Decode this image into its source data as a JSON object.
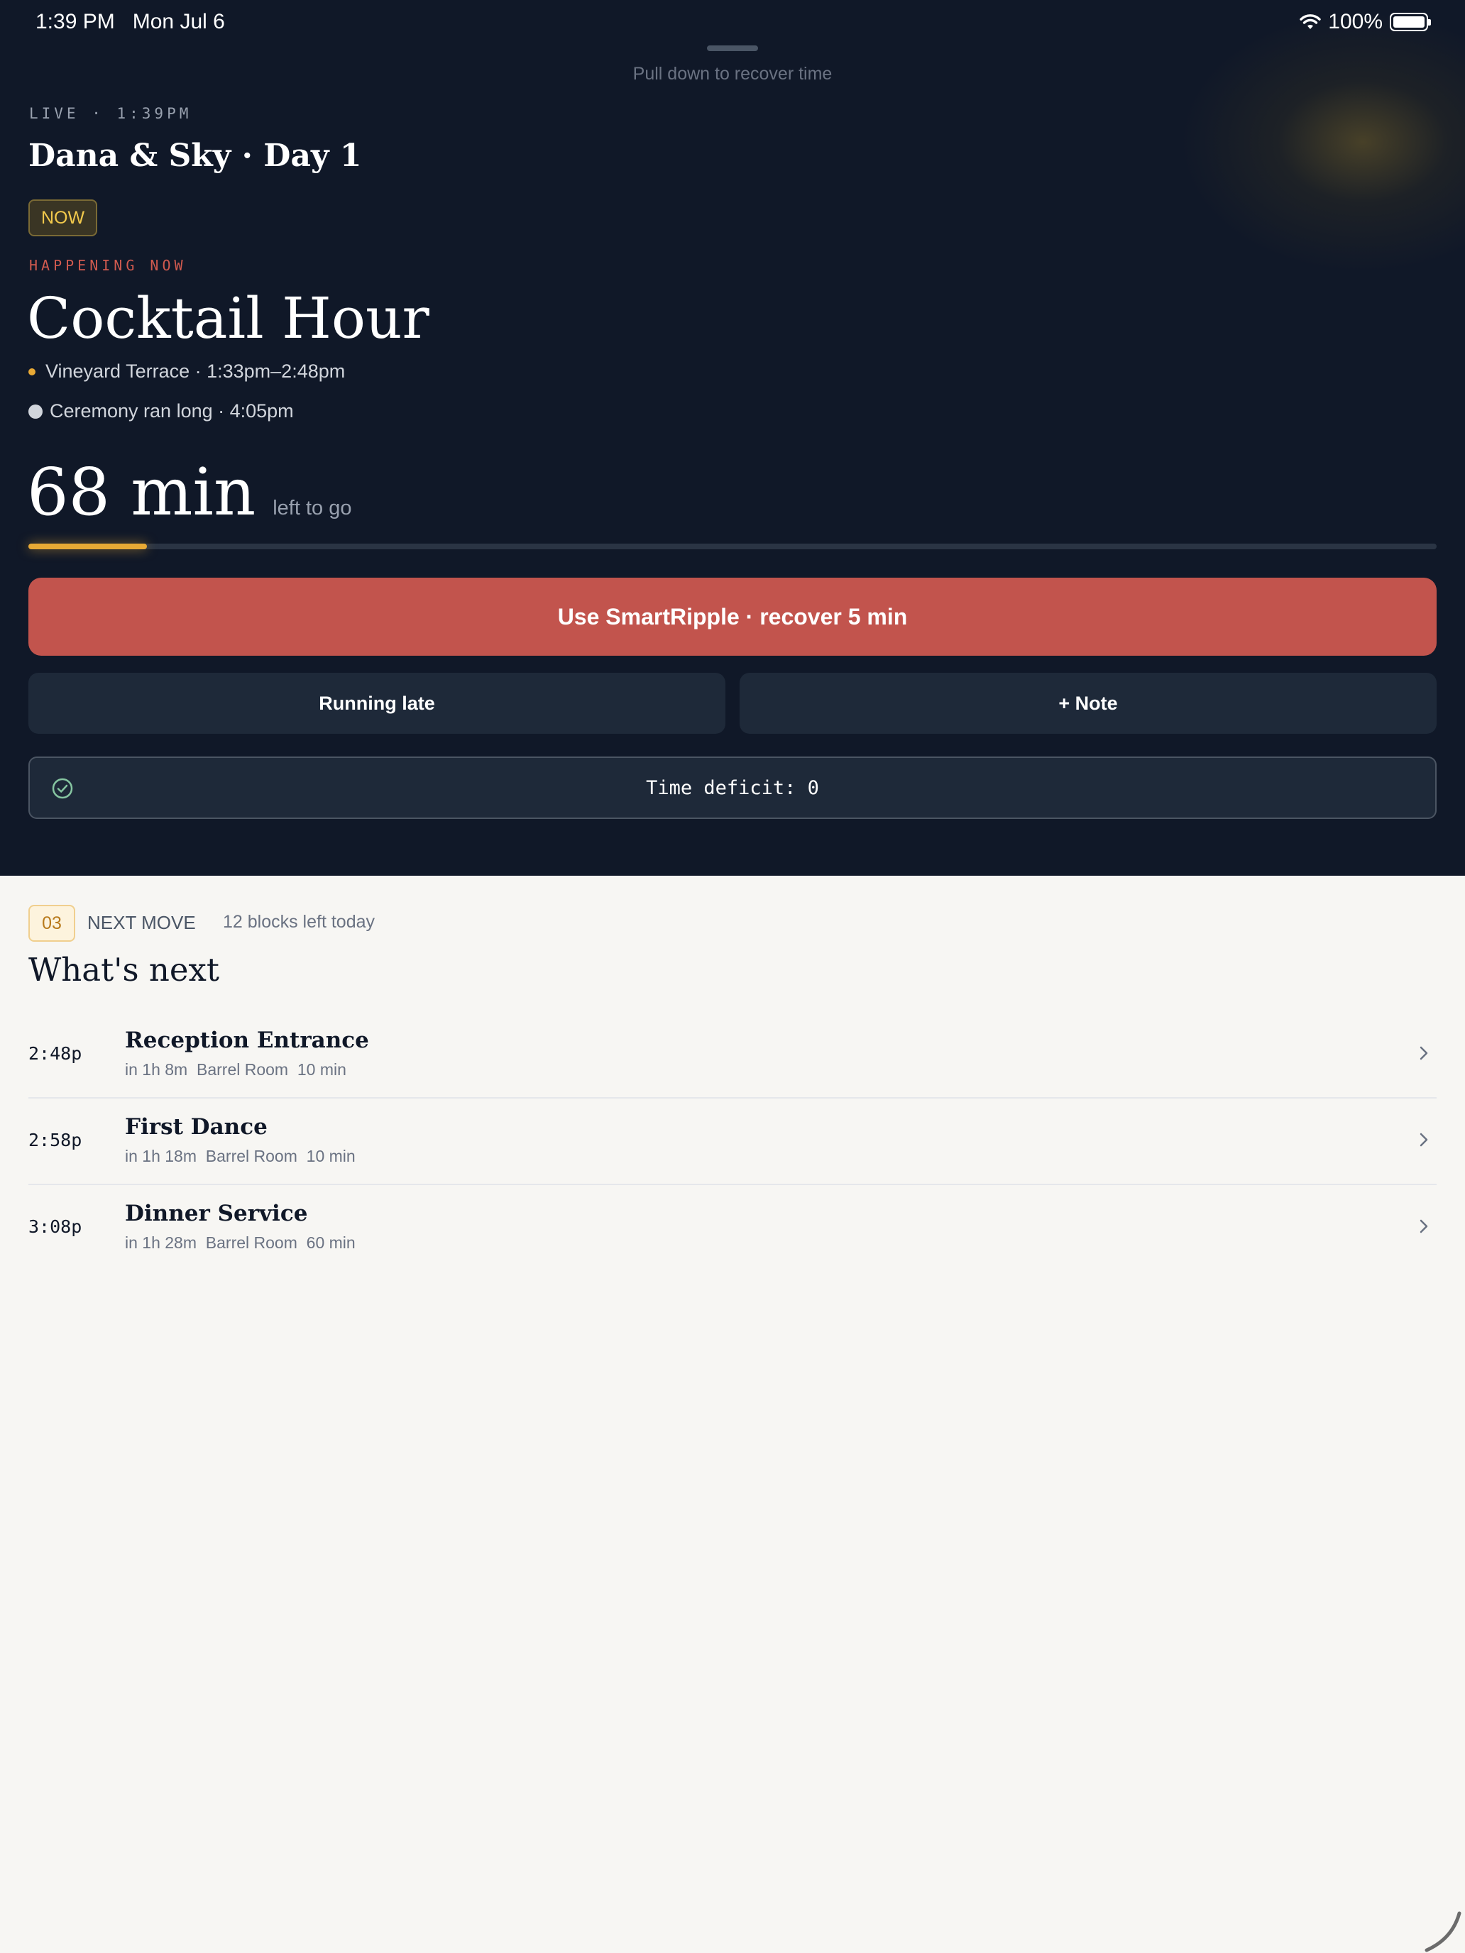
{
  "status_bar": {
    "time": "1:39 PM",
    "date": "Mon Jul 6",
    "battery": "100%"
  },
  "pull_hint": "Pull down to recover time",
  "live_label": "LIVE · 1:39PM",
  "event_title": "Dana & Sky · Day 1",
  "now_badge": "NOW",
  "happening_label": "HAPPENING NOW",
  "current": {
    "title": "Cocktail Hour",
    "location_time": "Vineyard Terrace · 1:33pm–2:48pm",
    "delay_note": "Ceremony ran long · 4:05pm",
    "remaining_value": "68 min",
    "remaining_label": "left to go",
    "progress_fraction": 0.084
  },
  "actions": {
    "primary": "Use SmartRipple · recover 5 min",
    "running_late": "Running late",
    "note": "+ Note"
  },
  "deficit": {
    "text": "Time deficit: 0",
    "icon": "check-circle-icon"
  },
  "next_section": {
    "badge": "03",
    "label": "NEXT MOVE",
    "blocks_left": "12 blocks left today",
    "heading": "What's next",
    "items": [
      {
        "time": "2:48p",
        "title": "Reception Entrance",
        "meta": "in 1h 8m  Barrel Room  10 min"
      },
      {
        "time": "2:58p",
        "title": "First Dance",
        "meta": "in 1h 18m  Barrel Room  10 min"
      },
      {
        "time": "3:08p",
        "title": "Dinner Service",
        "meta": "in 1h 28m  Barrel Room  60 min"
      }
    ]
  },
  "colors": {
    "dark_bg": "#101828",
    "accent_gold": "#e8a935",
    "primary_red": "#c2544d",
    "light_bg": "#f7f6f3"
  }
}
